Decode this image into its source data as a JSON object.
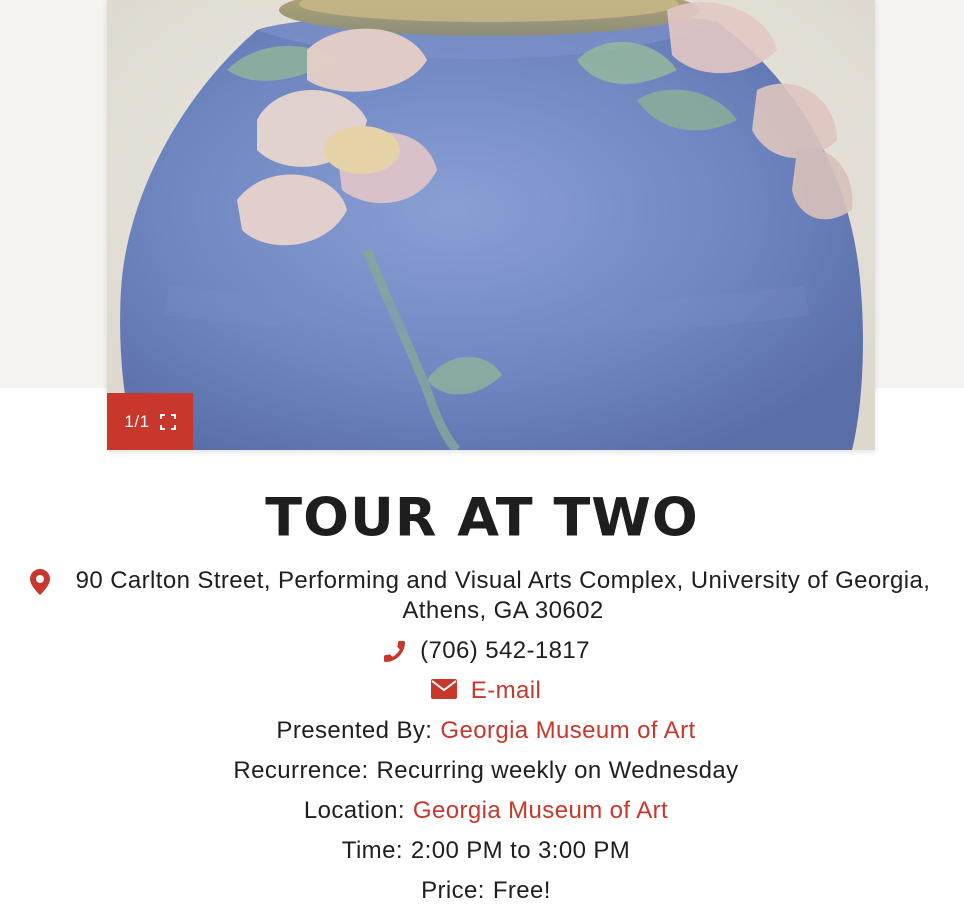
{
  "gallery": {
    "image_alt": "Blue ceramic vase with pale pink flower decoration",
    "counter": "1/1",
    "fullscreen_icon": "expand-icon"
  },
  "event": {
    "title": "TOUR AT TWO",
    "address": "90 Carlton Street, Performing and Visual Arts Complex, University of Georgia, Athens, GA 30602",
    "phone": "(706) 542-1817",
    "email_label": "E-mail",
    "presented_by_label": "Presented By:",
    "presented_by_value": "Georgia Museum of Art",
    "recurrence_label": "Recurrence:",
    "recurrence_value": "Recurring weekly on Wednesday",
    "location_label": "Location:",
    "location_value": "Georgia Museum of Art",
    "time_label": "Time:",
    "time_value": "2:00 PM to 3:00 PM",
    "price_label": "Price:",
    "price_value": "Free!"
  },
  "icons": {
    "address": "map-marker-icon",
    "phone": "phone-icon",
    "email": "envelope-icon"
  },
  "colors": {
    "accent": "#c8372b",
    "hero_background": "#f6f4f1",
    "vase_blue": "#6f86c1"
  }
}
